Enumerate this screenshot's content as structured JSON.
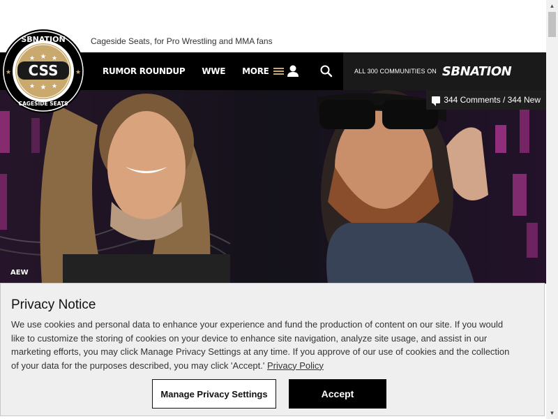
{
  "site": {
    "tagline": "Cageside Seats, for Pro Wrestling and MMA fans"
  },
  "logo": {
    "top_text": "SBNATION",
    "center_text": "CSS",
    "bottom_text": "CAGESIDE SEATS"
  },
  "nav": {
    "links": [
      "RUMOR ROUNDUP",
      "WWE",
      "MORE"
    ],
    "communities_text": "ALL 300 COMMUNITIES ON",
    "sbnation_wordmark": "SBNATION"
  },
  "hero": {
    "comments_badge": "344 Comments / 344 New",
    "category_tag": "AEW"
  },
  "privacy": {
    "title": "Privacy Notice",
    "body": "We use cookies and personal data to enhance your experience and fund the production of content on our site. If you would like to customize the storing of cookies on your device to enhance site navigation, analyze site usage, and assist in our marketing efforts, you may click Manage Privacy Settings at any time. If you approve of our use of cookies and the collection of your data for the purposes described, you may click 'Accept.'",
    "link_text": "Privacy Policy",
    "manage_button": "Manage Privacy Settings",
    "accept_button": "Accept"
  },
  "colors": {
    "nav_bg": "#000000",
    "sbn_bg": "#1a1a1a",
    "accent_gold": "#c9a96e",
    "privacy_bg": "#efefef",
    "hero_bg": "#17151c"
  },
  "icons": {
    "user": "user-icon",
    "search": "search-icon",
    "menu": "hamburger-icon",
    "comments": "comment-bubble-icon"
  }
}
